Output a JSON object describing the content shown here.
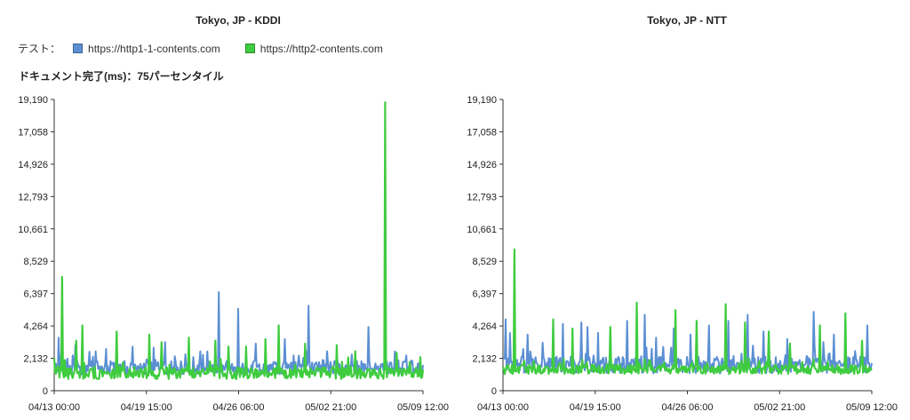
{
  "legend": {
    "label": "テスト：",
    "items": [
      {
        "name": "https://http1-1-contents.com",
        "color": "#5B8FD3"
      },
      {
        "name": "https://http2-contents.com",
        "color": "#3FCC3F"
      }
    ]
  },
  "subtitle": "ドキュメント完了(ms)：75パーセンタイル",
  "chart_data": [
    {
      "type": "line",
      "title": "Tokyo, JP - KDDI",
      "xlabel": "",
      "ylabel": "",
      "x_ticks": [
        "04/13 00:00",
        "04/19 15:00",
        "04/26 06:00",
        "05/02 21:00",
        "05/09 12:00"
      ],
      "y_ticks": [
        "0",
        "2,132",
        "4,264",
        "6,397",
        "8,529",
        "10,661",
        "12,793",
        "14,926",
        "17,058",
        "19,190"
      ],
      "ylim": [
        0,
        19190
      ],
      "xlim_days": [
        0,
        26.5
      ],
      "series": [
        {
          "name": "https://http1-1-contents.com",
          "color": "#5B8FD3",
          "baseline": 1500,
          "noise": 450,
          "spikes": [
            [
              0.3,
              3500
            ],
            [
              1.5,
              3000
            ],
            [
              3.0,
              2600
            ],
            [
              5.6,
              2900
            ],
            [
              8.0,
              3200
            ],
            [
              9.4,
              2400
            ],
            [
              11.8,
              6500
            ],
            [
              13.2,
              5400
            ],
            [
              14.5,
              3100
            ],
            [
              16.6,
              3400
            ],
            [
              18.3,
              5600
            ],
            [
              19.6,
              2600
            ],
            [
              22.6,
              4200
            ],
            [
              24.5,
              2600
            ],
            [
              25.7,
              2000
            ]
          ]
        },
        {
          "name": "https://http2-contents.com",
          "color": "#3FCC3F",
          "baseline": 1150,
          "noise": 380,
          "spikes": [
            [
              0.6,
              7500
            ],
            [
              1.6,
              3300
            ],
            [
              2.0,
              4300
            ],
            [
              4.5,
              3900
            ],
            [
              6.8,
              3700
            ],
            [
              7.7,
              3200
            ],
            [
              9.7,
              3500
            ],
            [
              11.6,
              3300
            ],
            [
              12.5,
              2900
            ],
            [
              13.8,
              2900
            ],
            [
              15.2,
              3400
            ],
            [
              16.1,
              4300
            ],
            [
              18.0,
              3100
            ],
            [
              20.3,
              3000
            ],
            [
              21.6,
              2600
            ],
            [
              23.8,
              19000
            ],
            [
              24.6,
              2500
            ]
          ]
        }
      ]
    },
    {
      "type": "line",
      "title": "Tokyo, JP - NTT",
      "xlabel": "",
      "ylabel": "",
      "x_ticks": [
        "04/13 00:00",
        "04/19 15:00",
        "04/26 06:00",
        "05/02 21:00",
        "05/09 12:00"
      ],
      "y_ticks": [
        "0",
        "2,132",
        "4,264",
        "6,397",
        "8,529",
        "10,661",
        "12,793",
        "14,926",
        "17,058",
        "19,190"
      ],
      "ylim": [
        0,
        19190
      ],
      "xlim_days": [
        0,
        26.5
      ],
      "series": [
        {
          "name": "https://http1-1-contents.com",
          "color": "#5B8FD3",
          "baseline": 1700,
          "noise": 550,
          "spikes": [
            [
              0.2,
              4700
            ],
            [
              0.5,
              3800
            ],
            [
              1.8,
              3700
            ],
            [
              4.3,
              4400
            ],
            [
              5.6,
              4500
            ],
            [
              6.1,
              4200
            ],
            [
              6.8,
              3800
            ],
            [
              8.9,
              4600
            ],
            [
              10.2,
              5000
            ],
            [
              11.0,
              3500
            ],
            [
              12.3,
              4100
            ],
            [
              13.5,
              3700
            ],
            [
              14.8,
              4300
            ],
            [
              16.2,
              4600
            ],
            [
              17.6,
              5000
            ],
            [
              18.7,
              3900
            ],
            [
              20.4,
              3400
            ],
            [
              22.3,
              5200
            ],
            [
              23.8,
              3700
            ],
            [
              26.2,
              4300
            ]
          ]
        },
        {
          "name": "https://http2-contents.com",
          "color": "#3FCC3F",
          "baseline": 1400,
          "noise": 300,
          "spikes": [
            [
              0.8,
              9300
            ],
            [
              3.6,
              4700
            ],
            [
              5.0,
              4100
            ],
            [
              7.7,
              4200
            ],
            [
              9.6,
              5800
            ],
            [
              12.4,
              5300
            ],
            [
              13.9,
              4600
            ],
            [
              16.0,
              5700
            ],
            [
              17.4,
              4500
            ],
            [
              19.1,
              3900
            ],
            [
              20.6,
              3100
            ],
            [
              22.8,
              4300
            ],
            [
              24.6,
              5100
            ],
            [
              25.8,
              3300
            ]
          ]
        }
      ]
    }
  ]
}
